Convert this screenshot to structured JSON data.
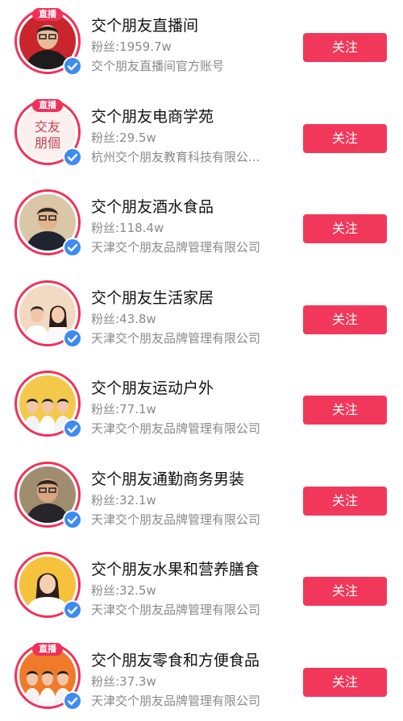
{
  "accounts": [
    {
      "name": "交个朋友直播间",
      "fans": "粉丝:1959.7w",
      "desc": "交个朋友直播间官方账号",
      "badge": "直播",
      "follow": "关注",
      "avatar_icon": "man-glasses-avatar",
      "bg": "#c9252c"
    },
    {
      "name": "交个朋友电商学苑",
      "fans": "粉丝:29.5w",
      "desc": "杭州交个朋友教育科技有限公...",
      "badge": "直播",
      "follow": "关注",
      "avatar_icon": "logo-text-avatar",
      "logo_text": "交友朋個",
      "bg": "#fbeff0"
    },
    {
      "name": "交个朋友酒水食品",
      "fans": "粉丝:118.4w",
      "desc": "天津交个朋友品牌管理有限公司",
      "badge": "",
      "follow": "关注",
      "avatar_icon": "man-suit-avatar",
      "bg": "#d9c7a8"
    },
    {
      "name": "交个朋友生活家居",
      "fans": "粉丝:43.8w",
      "desc": "天津交个朋友品牌管理有限公司",
      "badge": "",
      "follow": "关注",
      "avatar_icon": "couple-avatar",
      "bg": "#f2d9c2"
    },
    {
      "name": "交个朋友运动户外",
      "fans": "粉丝:77.1w",
      "desc": "天津交个朋友品牌管理有限公司",
      "badge": "",
      "follow": "关注",
      "avatar_icon": "group-avatar",
      "bg": "#f4c84a"
    },
    {
      "name": "交个朋友通勤商务男装",
      "fans": "粉丝:32.1w",
      "desc": "天津交个朋友品牌管理有限公司",
      "badge": "",
      "follow": "关注",
      "avatar_icon": "man-beard-avatar",
      "bg": "#a08d70"
    },
    {
      "name": "交个朋友水果和营养膳食",
      "fans": "粉丝:32.5w",
      "desc": "天津交个朋友品牌管理有限公司",
      "badge": "",
      "follow": "关注",
      "avatar_icon": "woman-avatar",
      "bg": "#f6c13c"
    },
    {
      "name": "交个朋友零食和方便食品",
      "fans": "粉丝:37.3w",
      "desc": "天津交个朋友品牌管理有限公司",
      "badge": "直播",
      "follow": "关注",
      "avatar_icon": "group-orange-avatar",
      "bg": "#ef7b2a"
    }
  ],
  "colors": {
    "accent": "#f2385a",
    "verified": "#3d8bf0"
  }
}
